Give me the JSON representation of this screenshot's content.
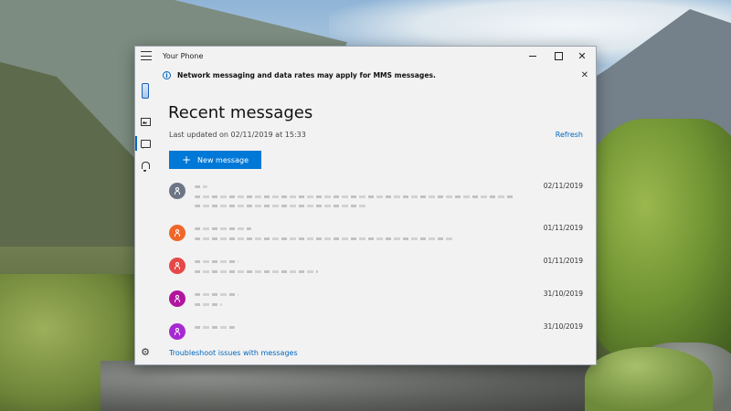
{
  "window": {
    "app_title": "Your Phone"
  },
  "infobar": {
    "icon": "info-icon",
    "text": "Network messaging and data rates may apply for MMS messages."
  },
  "sidebar": {
    "items": [
      {
        "icon": "phone-icon"
      },
      {
        "icon": "photos-icon"
      },
      {
        "icon": "messages-icon",
        "active": true
      },
      {
        "icon": "notifications-icon"
      },
      {
        "icon": "settings-icon"
      }
    ]
  },
  "main": {
    "title": "Recent messages",
    "last_updated": "Last updated on 02/11/2019 at 15:33",
    "refresh_label": "Refresh",
    "new_message_label": "New message",
    "conversations": [
      {
        "date": "02/11/2019",
        "avatar_color": "#6e7686"
      },
      {
        "date": "01/11/2019",
        "avatar_color": "#f0662a"
      },
      {
        "date": "01/11/2019",
        "avatar_color": "#e64848"
      },
      {
        "date": "31/10/2019",
        "avatar_color": "#b0159e"
      },
      {
        "date": "31/10/2019",
        "avatar_color": "#a62ad1"
      }
    ],
    "troubleshoot_label": "Troubleshoot issues with messages"
  },
  "colors": {
    "accent": "#0078d7",
    "link": "#0067c0"
  }
}
